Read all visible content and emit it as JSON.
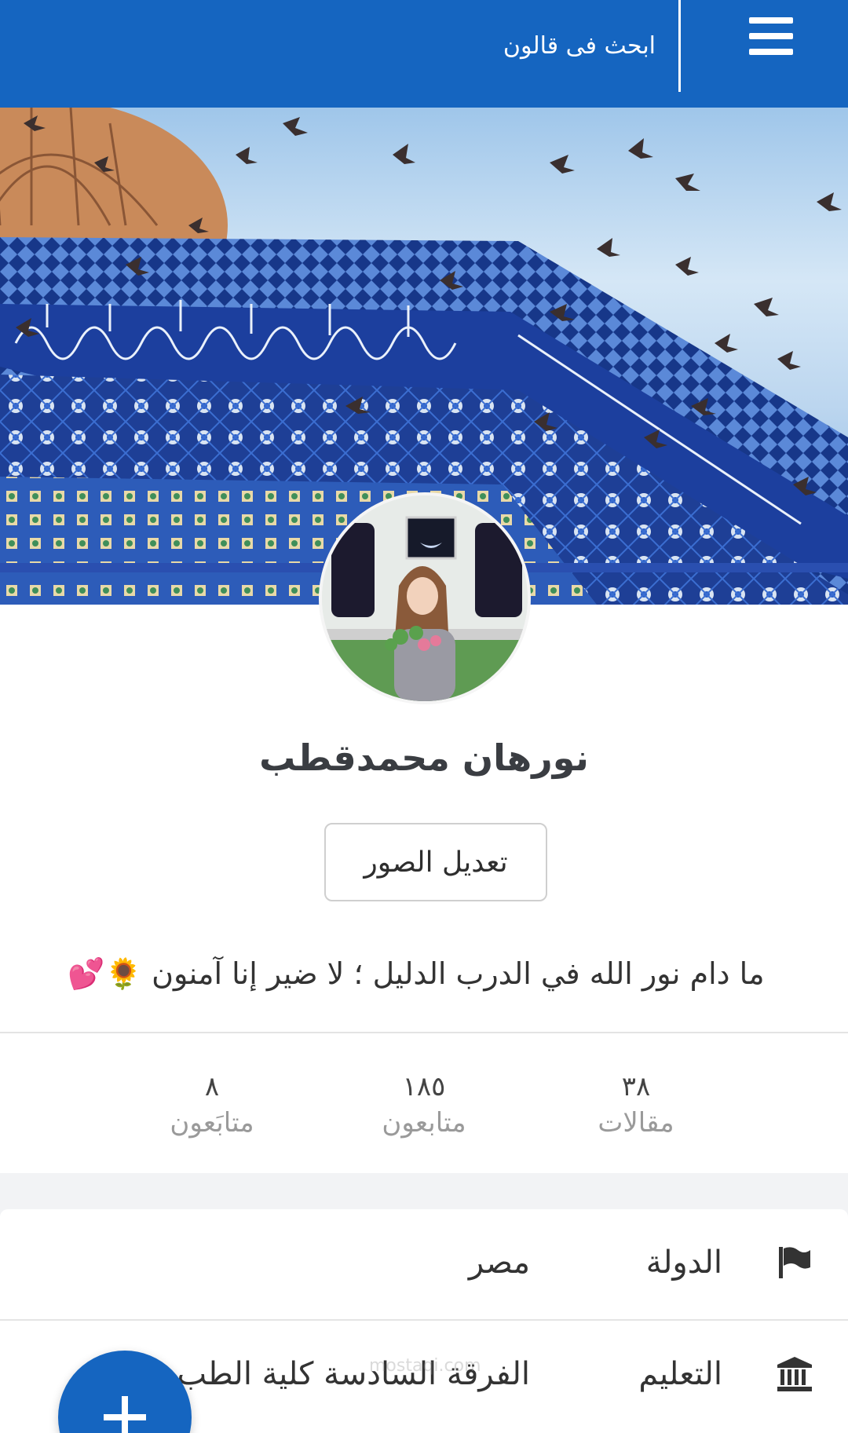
{
  "header": {
    "search_label": "ابحث فى قالون",
    "menu_icon": "hamburger-menu-icon",
    "background": "#1565c0"
  },
  "profile": {
    "name": "نورهان محمدقطب",
    "edit_photos_label": "تعديل الصور",
    "bio": "ما دام نور الله في الدرب الدليل ؛ لا ضير إنا آمنون 🌻💕"
  },
  "stats": [
    {
      "value": "٣٨",
      "label": "مقالات"
    },
    {
      "value": "١٨٥",
      "label": "متابعون"
    },
    {
      "value": "٨",
      "label": "متابَعون"
    }
  ],
  "info": {
    "country": {
      "label": "الدولة",
      "value": "مصر",
      "icon": "flag-icon"
    },
    "education": {
      "label": "التعليم",
      "value": "الفرقة السادسة كلية الطب",
      "icon": "institution-icon"
    }
  },
  "fab": {
    "icon": "plus-icon"
  },
  "watermark": "mostaqi.com"
}
